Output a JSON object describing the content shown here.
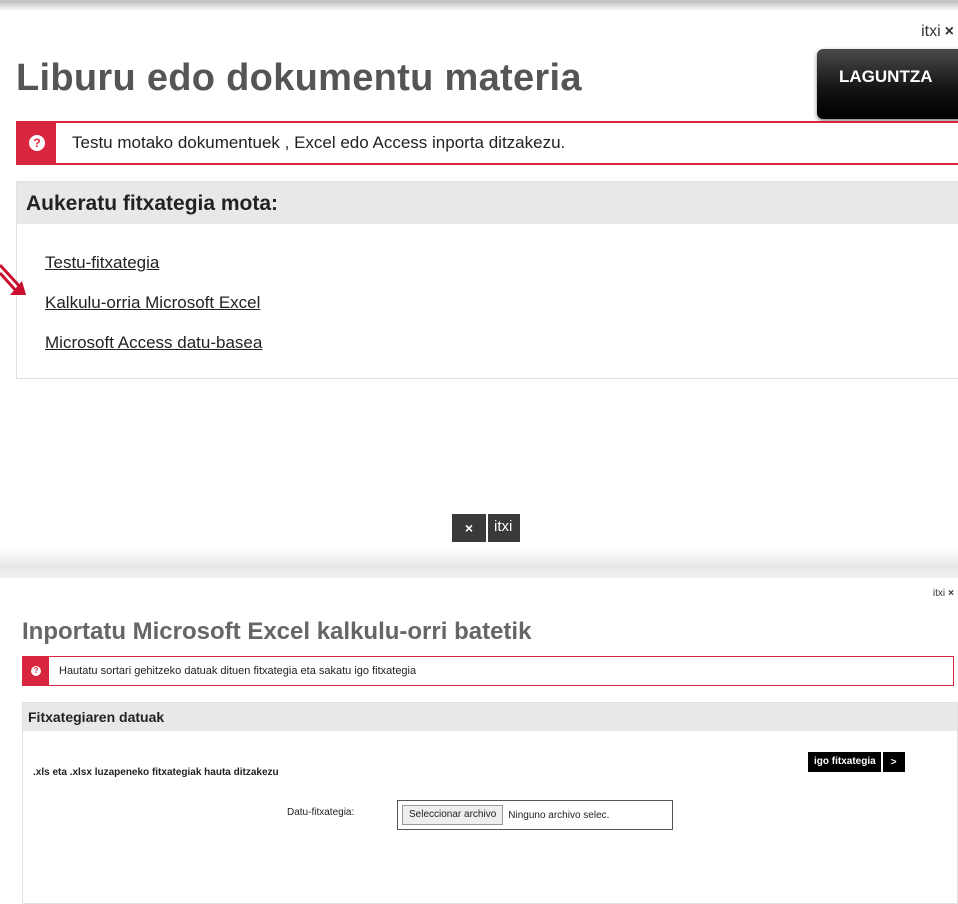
{
  "panel1": {
    "close_label": "itxi",
    "close_icon": "×",
    "title": "Liburu edo dokumentu materia",
    "help_label": "LAGUNTZA",
    "alert_icon": "?",
    "alert_text": "Testu motako dokumentuek , Excel edo Access inporta ditzakezu.",
    "section_title": "Aukeratu fitxategia mota:",
    "options": [
      {
        "label": "Testu-fitxategia"
      },
      {
        "label": "Kalkulu-orria Microsoft Excel"
      },
      {
        "label": "Microsoft Access datu-basea"
      }
    ],
    "bottom_close_icon": "×",
    "bottom_close_label": "itxi"
  },
  "panel2": {
    "close_label": "itxi",
    "close_icon": "×",
    "title": "Inportatu Microsoft Excel kalkulu-orri batetik",
    "alert_icon": "?",
    "alert_text": "Hautatu sortari gehitzeko datuak dituen fitxategia eta sakatu igo fitxategia",
    "section_title": "Fitxategiaren datuak",
    "hint": ".xls eta .xlsx luzapeneko fitxategiak hauta ditzakezu",
    "field_label": "Datu-fitxategia:",
    "file_button": "Seleccionar archivo",
    "file_status": "Ninguno archivo selec.",
    "upload_label": "igo fitxategia",
    "upload_icon": ">"
  },
  "colors": {
    "accent": "#d7263d",
    "dark_button": "#000000",
    "header_bg": "#e8e8e8"
  }
}
